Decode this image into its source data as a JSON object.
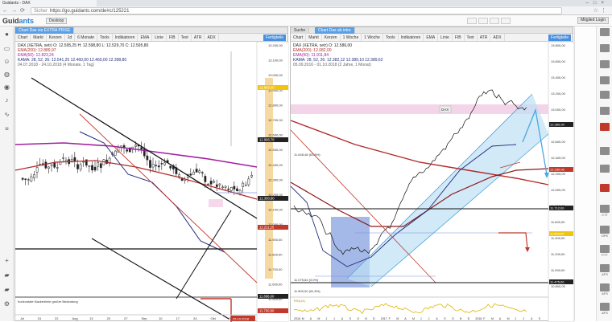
{
  "browser": {
    "tab_title": "Guidants - DAX",
    "url_prefix": "Sicher",
    "url": "https://go.guidants.com/de#c/125221",
    "window_controls": [
      "–",
      "□",
      "×"
    ]
  },
  "app": {
    "logo_main": "Guid",
    "logo_accent": "ants",
    "desktop_button": "Desktop",
    "member_button": "Mitglied Login"
  },
  "left_panel": {
    "tab": "Chart Dax via EXTRA PRISE",
    "toolbar": [
      "Chart",
      "Markt",
      "Kerzen",
      "1d",
      "6 Monate",
      "Tools",
      "Indikatoren",
      "EMA",
      "Linie",
      "FIB",
      "Text",
      "ATR",
      "ADX"
    ],
    "toolbar_selected": "Fertigteile",
    "legend": [
      "DAX (XETRA, xetr) O: 12.595,25 H: 12.598,80 L: 12.529,70 C: 12.595,80",
      "EMA(200): 12.889,97",
      "EMA(50): 12.823,24",
      "KAMA: 28, 52, 26: 12.541,25 12.460,00 12.460,00 12.398,80",
      "04.07.2018 - 24.10.2018 (4 Monate, 1 Tag)"
    ],
    "y_ticks": [
      "13.200,00",
      "13.100,00",
      "13.000,00",
      "12.900,00",
      "12.800,00",
      "12.700,00",
      "12.600,00",
      "12.500,00",
      "12.400,00",
      "12.300,00",
      "12.200,00",
      "12.100,00",
      "12.000,00",
      "11.900,00",
      "11.800,00",
      "11.700,00",
      "11.600,00",
      "11.500,00"
    ],
    "price_labels": [
      "12.856,00",
      "12.966,78",
      "12.390,90",
      "12.211,25",
      "11.866,00",
      "11.700,80"
    ],
    "x_ticks": [
      "Jul",
      "15",
      "22",
      "Aug",
      "13",
      "20",
      "27",
      "Sep",
      "10",
      "17",
      "24",
      "Okt",
      "15",
      "22"
    ],
    "note": "horizontale Nackenlinie großer Bedeutung",
    "date_label": "25.10.2018"
  },
  "right_panel": {
    "tab": "Chart Dax ab intra",
    "toolbar": [
      "Chart",
      "Markt",
      "Kerzen",
      "1 Woche",
      "1 Woche",
      "Tools",
      "Indikatoren",
      "EMA",
      "Linie",
      "FIB",
      "Text",
      "ATR",
      "ADX"
    ],
    "toolbar_selected": "Fertigteile",
    "legend": [
      "DAX (XETRA, xetr) O: 12.586,00",
      "EMA(200): 12.082,00",
      "EMA(50): 11.911,84",
      "KAMA: 28, 52, 26: 12.382,12 12.389,10 12.389,62",
      "05.09.2016 - 01.10.2018 (2 Jahre, 1 Monat)"
    ],
    "chart_labels": [
      "DAX",
      "11.648,48 (61,8%)",
      "11.075,64 (0,0%)",
      "11.800,00 (61,8%)"
    ],
    "y_ticks": [
      "13.800,00",
      "13.600,00",
      "13.400,00",
      "13.200,00",
      "13.000,00",
      "12.800,00",
      "12.600,00",
      "12.400,00",
      "12.200,00",
      "12.000,00",
      "11.800,00",
      "11.600,00",
      "11.400,00",
      "11.200,00",
      "11.000,00",
      "10.800,00"
    ],
    "price_labels": [
      "12.389,90",
      "12.180,00",
      "11.712,00",
      "11.800,50",
      "11.475,00"
    ],
    "x_ticks": [
      "2016",
      "M",
      "A",
      "M",
      "J",
      "J",
      "A",
      "S",
      "O",
      "N",
      "D",
      "2017",
      "F",
      "M",
      "A",
      "M",
      "J",
      "J",
      "A",
      "S",
      "O",
      "N",
      "D",
      "2018",
      "F",
      "M",
      "A",
      "M",
      "J",
      "J",
      "A",
      "S"
    ],
    "indicator_label": "RSI(14)"
  },
  "right_strip": {
    "items": [
      "CTT",
      "OPK",
      "PTT",
      "AFS",
      "AFS",
      "AFS"
    ]
  },
  "colors": {
    "accent": "#4a8fdc",
    "candle_up": "#ffffff",
    "candle_down": "#222222",
    "ema_red": "#b22a2a",
    "ema_purple": "#a020a0",
    "kama_navy": "#1f2d7a",
    "channel_fill": "#bfe0f5",
    "channel_line": "#4aa8e0",
    "highlight_pink": "#f3cfe6",
    "highlight_blue": "#5b7fd6",
    "axis_yellow": "#f6d9a0"
  }
}
